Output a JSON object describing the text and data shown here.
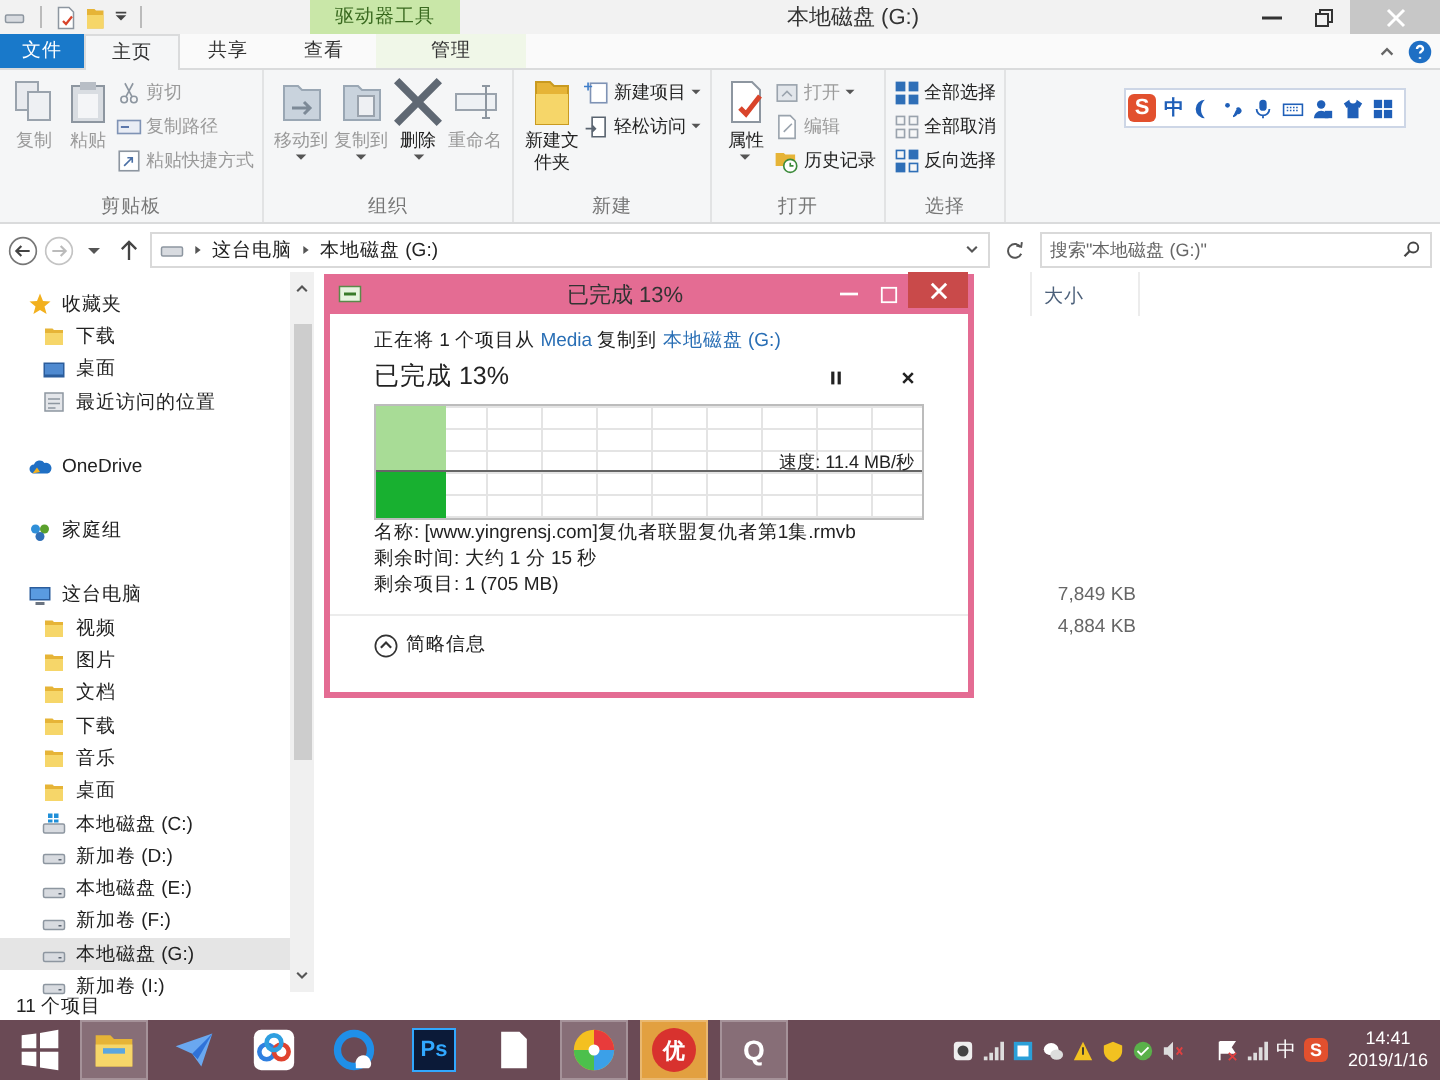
{
  "window": {
    "title": "本地磁盘 (G:)",
    "context_tab_group": "驱动器工具"
  },
  "ribbon": {
    "tabs": [
      {
        "label": "文件",
        "kind": "file",
        "selected": false
      },
      {
        "label": "主页",
        "kind": "tab",
        "selected": true
      },
      {
        "label": "共享",
        "kind": "tab",
        "selected": false
      },
      {
        "label": "查看",
        "kind": "tab",
        "selected": false
      },
      {
        "label": "管理",
        "kind": "context",
        "selected": false
      }
    ],
    "groups": [
      {
        "label": "剪贴板",
        "large": [
          {
            "label": "复制",
            "disabled": true,
            "dropdown": false
          },
          {
            "label": "粘贴",
            "disabled": true,
            "dropdown": false
          }
        ],
        "small": [
          {
            "label": "剪切",
            "disabled": true,
            "dropdown": false
          },
          {
            "label": "复制路径",
            "disabled": true,
            "dropdown": false
          },
          {
            "label": "粘贴快捷方式",
            "disabled": true,
            "dropdown": false
          }
        ]
      },
      {
        "label": "组织",
        "large": [
          {
            "label": "移动到",
            "disabled": true,
            "dropdown": true
          },
          {
            "label": "复制到",
            "disabled": true,
            "dropdown": true
          },
          {
            "label": "删除",
            "disabled": false,
            "dropdown": true
          },
          {
            "label": "重命名",
            "disabled": true,
            "dropdown": false
          }
        ]
      },
      {
        "label": "新建",
        "large": [
          {
            "label": "新建文件夹",
            "disabled": false,
            "dropdown": false
          }
        ],
        "small": [
          {
            "label": "新建项目",
            "disabled": false,
            "dropdown": true
          },
          {
            "label": "轻松访问",
            "disabled": false,
            "dropdown": true
          }
        ]
      },
      {
        "label": "打开",
        "large": [
          {
            "label": "属性",
            "disabled": false,
            "dropdown": true
          }
        ],
        "small": [
          {
            "label": "打开",
            "disabled": true,
            "dropdown": true
          },
          {
            "label": "编辑",
            "disabled": true,
            "dropdown": false
          },
          {
            "label": "历史记录",
            "disabled": false,
            "dropdown": false
          }
        ]
      },
      {
        "label": "选择",
        "small": [
          {
            "label": "全部选择",
            "disabled": false,
            "dropdown": false
          },
          {
            "label": "全部取消",
            "disabled": false,
            "dropdown": false
          },
          {
            "label": "反向选择",
            "disabled": false,
            "dropdown": false
          }
        ]
      }
    ]
  },
  "ime_toolbar": {
    "logo": "S",
    "mode": "中"
  },
  "address_bar": {
    "crumbs": [
      "这台电脑",
      "本地磁盘 (G:)"
    ],
    "search_placeholder": "搜索\"本地磁盘 (G:)\""
  },
  "sidebar": {
    "items": [
      {
        "label": "收藏夹",
        "kind": "favorites",
        "selected": false,
        "children": [
          {
            "label": "下载",
            "kind": "folder",
            "selected": false
          },
          {
            "label": "桌面",
            "kind": "desktop",
            "selected": false
          },
          {
            "label": "最近访问的位置",
            "kind": "recent",
            "selected": false
          }
        ]
      },
      {
        "label": "OneDrive",
        "kind": "cloud",
        "selected": false
      },
      {
        "label": "家庭组",
        "kind": "homegroup",
        "selected": false
      },
      {
        "label": "这台电脑",
        "kind": "computer",
        "selected": false,
        "children": [
          {
            "label": "视频",
            "kind": "folder",
            "selected": false
          },
          {
            "label": "图片",
            "kind": "folder",
            "selected": false
          },
          {
            "label": "文档",
            "kind": "folder",
            "selected": false
          },
          {
            "label": "下载",
            "kind": "folder",
            "selected": false
          },
          {
            "label": "音乐",
            "kind": "folder",
            "selected": false
          },
          {
            "label": "桌面",
            "kind": "folder",
            "selected": false
          },
          {
            "label": "本地磁盘 (C:)",
            "kind": "system-drive",
            "selected": false
          },
          {
            "label": "新加卷 (D:)",
            "kind": "drive",
            "selected": false
          },
          {
            "label": "本地磁盘 (E:)",
            "kind": "drive",
            "selected": false
          },
          {
            "label": "新加卷 (F:)",
            "kind": "drive",
            "selected": false
          },
          {
            "label": "本地磁盘 (G:)",
            "kind": "drive",
            "selected": true
          },
          {
            "label": "新加卷 (I:)",
            "kind": "drive",
            "selected": false
          }
        ]
      }
    ]
  },
  "file_list": {
    "columns": [
      "大小"
    ],
    "rows": [
      {
        "size": "7,849 KB"
      },
      {
        "size": "4,884 KB"
      }
    ]
  },
  "status_bar": {
    "text": "11 个项目"
  },
  "copy_dialog": {
    "title": "已完成 13%",
    "message": {
      "prefix": "正在将 1 个项目从",
      "source": "Media",
      "middle": "复制到",
      "destination": "本地磁盘 (G:)"
    },
    "heading": "已完成 13%",
    "level": 0.13,
    "speed": "速度: 11.4 MB/秒",
    "details": [
      "名称: [www.yingrensj.com]复仇者联盟复仇者第1集.rmvb",
      "剩余时间: 大约 1 分 15 秒",
      "剩余项目: 1 (705 MB)"
    ],
    "toggle": "简略信息"
  },
  "taskbar": {
    "items": [
      {
        "kind": "start",
        "running": false
      },
      {
        "kind": "explorer",
        "running": true
      },
      {
        "kind": "bird",
        "running": false
      },
      {
        "kind": "cloud",
        "running": false
      },
      {
        "kind": "browser",
        "running": false
      },
      {
        "kind": "ps",
        "label": "Ps",
        "running": false
      },
      {
        "kind": "file",
        "running": false
      },
      {
        "kind": "pinwheel",
        "running": true
      },
      {
        "kind": "you",
        "label": "优",
        "running": true
      },
      {
        "kind": "q",
        "label": "Q",
        "running": true
      }
    ],
    "tray": {
      "ime": "中",
      "ime_logo": "S",
      "time": "14:41",
      "date": "2019/1/16"
    }
  }
}
